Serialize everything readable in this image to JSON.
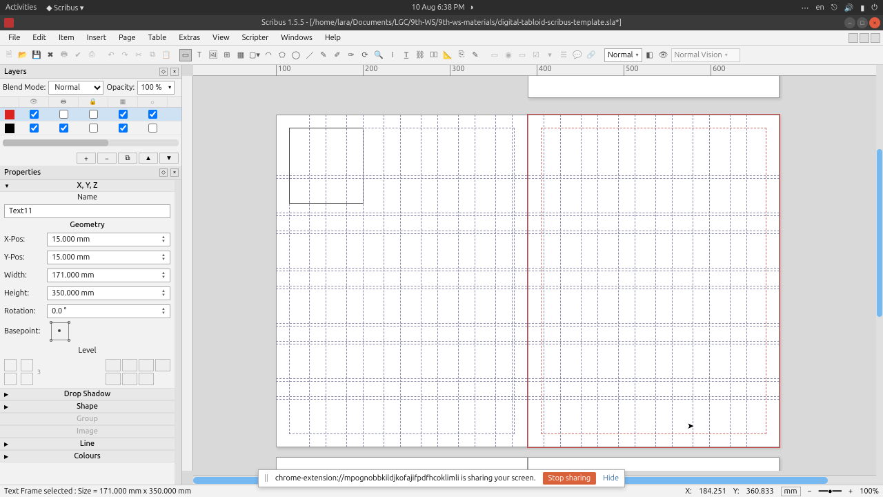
{
  "gnome": {
    "activities": "Activities",
    "app": "Scribus",
    "datetime": "10 Aug   6:38 PM",
    "lang": "en"
  },
  "titlebar": {
    "title": "Scribus 1.5.5 - [/home/lara/Documents/LGC/9th-WS/9th-ws-materials/digital-tabloid-scribus-template.sla*]"
  },
  "menubar": [
    "File",
    "Edit",
    "Item",
    "Insert",
    "Page",
    "Table",
    "Extras",
    "View",
    "Scripter",
    "Windows",
    "Help"
  ],
  "toolbar": {
    "display_mode": "Normal",
    "vision_mode": "Normal Vision"
  },
  "layers_panel": {
    "title": "Layers",
    "blendmode_label": "Blend Mode:",
    "blendmode_value": "Normal",
    "opacity_label": "Opacity:",
    "opacity_value": "100 %",
    "rows": [
      {
        "color": "#d22",
        "checks": [
          true,
          false,
          false,
          true,
          true,
          false
        ],
        "selected": true
      },
      {
        "color": "#000",
        "checks": [
          true,
          true,
          false,
          true,
          false,
          false
        ],
        "selected": false
      }
    ]
  },
  "properties_panel": {
    "title": "Properties",
    "xyz_label": "X, Y, Z",
    "name_label": "Name",
    "name_value": "Text11",
    "geometry_label": "Geometry",
    "xpos_label": "X-Pos:",
    "xpos_value": "15.000 mm",
    "ypos_label": "Y-Pos:",
    "ypos_value": "15.000 mm",
    "width_label": "Width:",
    "width_value": "171.000 mm",
    "height_label": "Height:",
    "height_value": "350.000 mm",
    "rotation_label": "Rotation:",
    "rotation_value": "0.0 °",
    "basepoint_label": "Basepoint:",
    "level_label": "Level",
    "sections": {
      "drop_shadow": "Drop Shadow",
      "shape": "Shape",
      "group": "Group",
      "image": "Image",
      "line": "Line",
      "colours": "Colours"
    }
  },
  "share": {
    "msg": "chrome-extension://mpognobbkildjkofajifpdfhcoklimli is sharing your screen.",
    "stop": "Stop sharing",
    "hide": "Hide"
  },
  "statusbar": {
    "left": "Text Frame selected : Size = 171.000 mm x 350.000 mm",
    "x_label": "X:",
    "x_val": "184.251",
    "y_label": "Y:",
    "y_val": "360.833",
    "unit": "mm",
    "zoom": "100%"
  },
  "ruler_h": [
    "100",
    "200",
    "300",
    "400",
    "500",
    "600"
  ],
  "ruler_v": []
}
